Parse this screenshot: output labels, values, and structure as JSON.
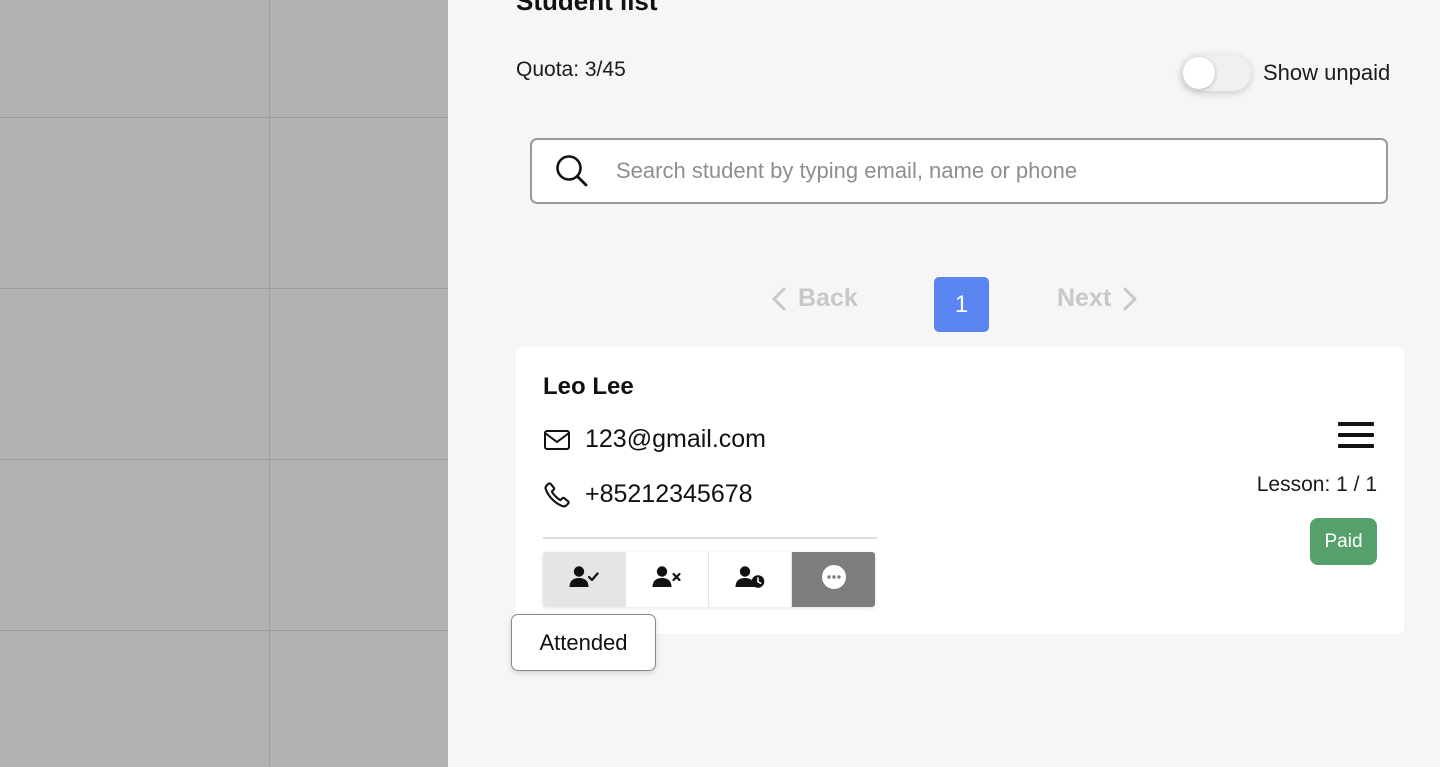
{
  "panel": {
    "title": "Student list",
    "quota": "Quota: 3/45",
    "toggle_label": "Show unpaid",
    "toggle_on": false
  },
  "search": {
    "placeholder": "Search student by typing email, name or phone",
    "value": ""
  },
  "pagination": {
    "back_label": "Back",
    "current_page": "1",
    "next_label": "Next"
  },
  "student": {
    "name": "Leo Lee",
    "email": "123@gmail.com",
    "phone": "+85212345678",
    "lesson": "Lesson: 1 / 1",
    "status": "Paid"
  },
  "actions": [
    {
      "name": "attended",
      "icon": "user-check-icon"
    },
    {
      "name": "absent",
      "icon": "user-x-icon"
    },
    {
      "name": "late",
      "icon": "user-clock-icon"
    },
    {
      "name": "more",
      "icon": "more-horizontal-icon"
    }
  ],
  "tooltip": {
    "text": "Attended"
  },
  "colors": {
    "accent": "#5a84f0",
    "paid": "#56a06b",
    "backdrop": "#b1b1b1"
  }
}
